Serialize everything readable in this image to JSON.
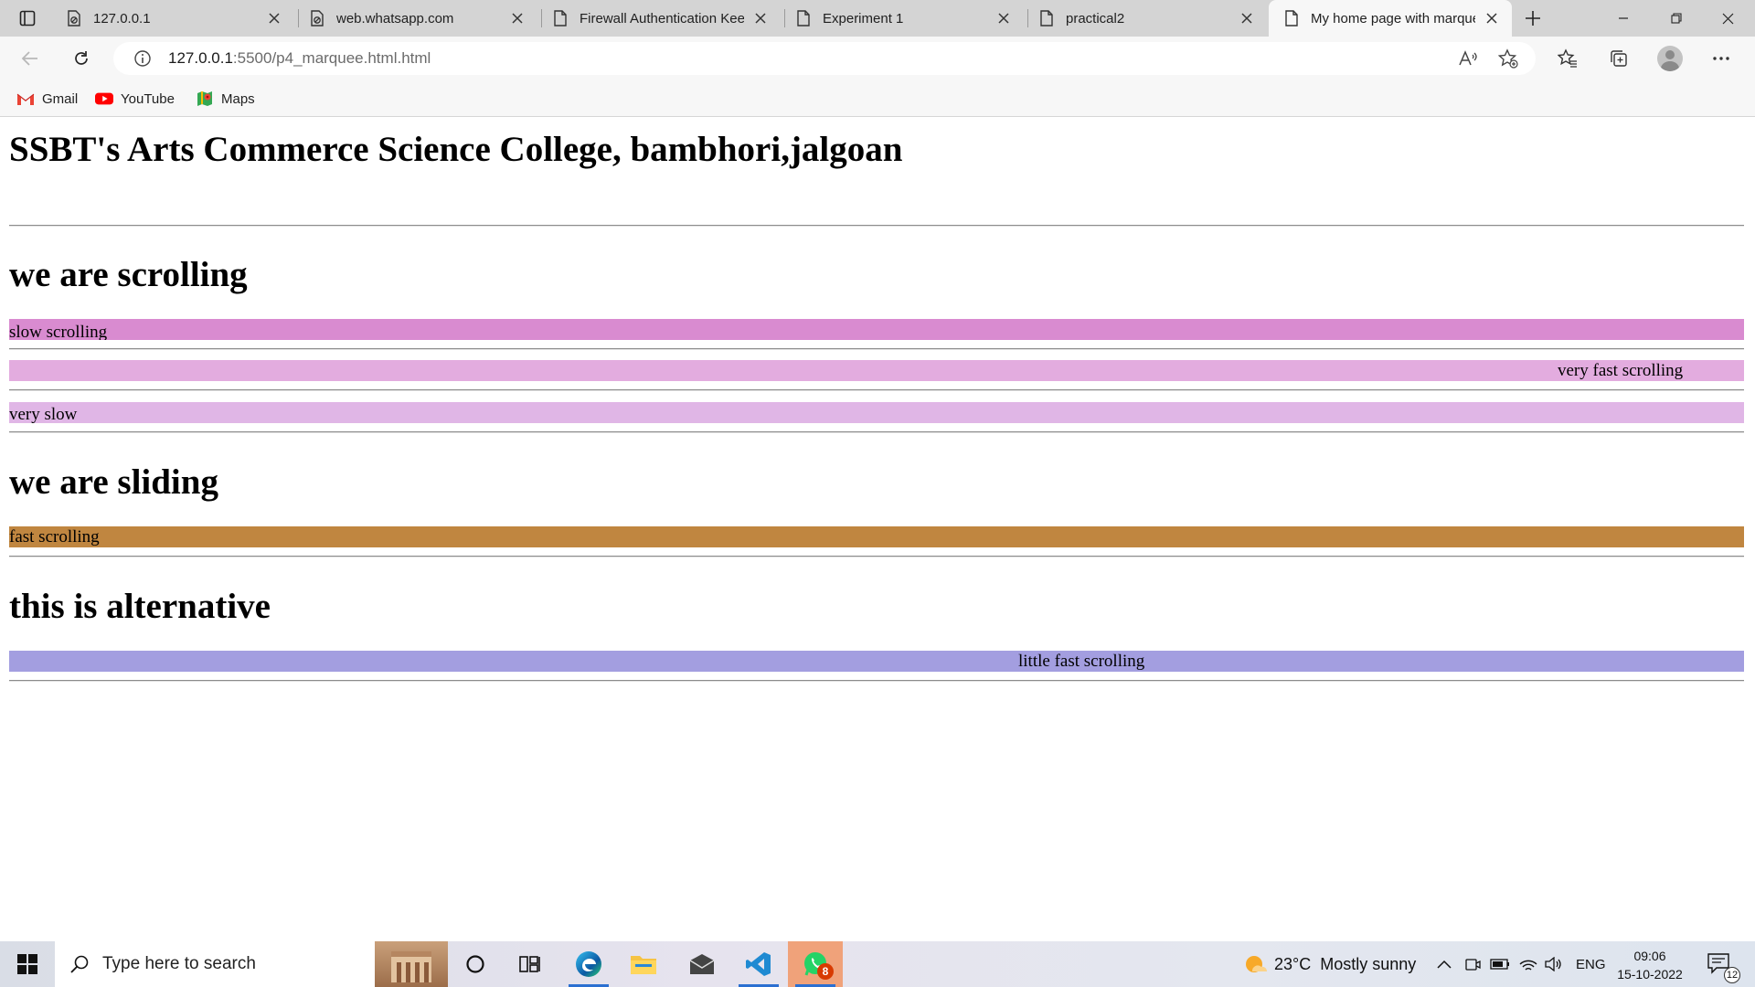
{
  "browser": {
    "tabs": [
      {
        "title": "127.0.0.1",
        "icon": "page-blocked-icon",
        "active": false
      },
      {
        "title": "web.whatsapp.com",
        "icon": "page-blocked-icon",
        "active": false
      },
      {
        "title": "Firewall Authentication Keep",
        "icon": "page-icon",
        "active": false
      },
      {
        "title": "Experiment 1",
        "icon": "page-icon",
        "active": false
      },
      {
        "title": "practical2",
        "icon": "page-icon",
        "active": false
      },
      {
        "title": "My home page with marque",
        "icon": "page-icon",
        "active": true
      }
    ],
    "address": {
      "host": "127.0.0.1",
      "path": ":5500/p4_marquee.html.html"
    },
    "bookmarks": [
      {
        "label": "Gmail",
        "icon": "gmail-icon"
      },
      {
        "label": "YouTube",
        "icon": "youtube-icon"
      },
      {
        "label": "Maps",
        "icon": "maps-icon"
      }
    ]
  },
  "page": {
    "title": "SSBT's Arts Commerce Science College, bambhori,jalgoan",
    "sections": [
      {
        "heading": "we are scrolling"
      },
      {
        "heading": "we are sliding"
      },
      {
        "heading": "this is alternative"
      }
    ],
    "marquees": [
      {
        "text": "slow scrolling",
        "bg": "#d98bd0"
      },
      {
        "text": "very fast scrolling",
        "bg": "#e3acdf"
      },
      {
        "text": "very slow",
        "bg": "#e0b6e6"
      },
      {
        "text": "fast scrolling",
        "bg": "#c08640"
      },
      {
        "text": "little fast scrolling",
        "bg": "#a39ee0"
      }
    ]
  },
  "taskbar": {
    "search_placeholder": "Type here to search",
    "apps": [
      "cortana-icon",
      "task-view-icon",
      "edge-icon",
      "file-explorer-icon",
      "mail-icon",
      "vscode-icon",
      "whatsapp-icon"
    ],
    "whatsapp_badge": "8",
    "weather": {
      "temp": "23°C",
      "condition": "Mostly sunny"
    },
    "language": "ENG",
    "time": "09:06",
    "date": "15-10-2022",
    "notification_count": "12"
  },
  "colors": {
    "accent": "#2b6fd1",
    "tabstrip": "#d4d4d4",
    "toolbar": "#f7f7f7"
  }
}
